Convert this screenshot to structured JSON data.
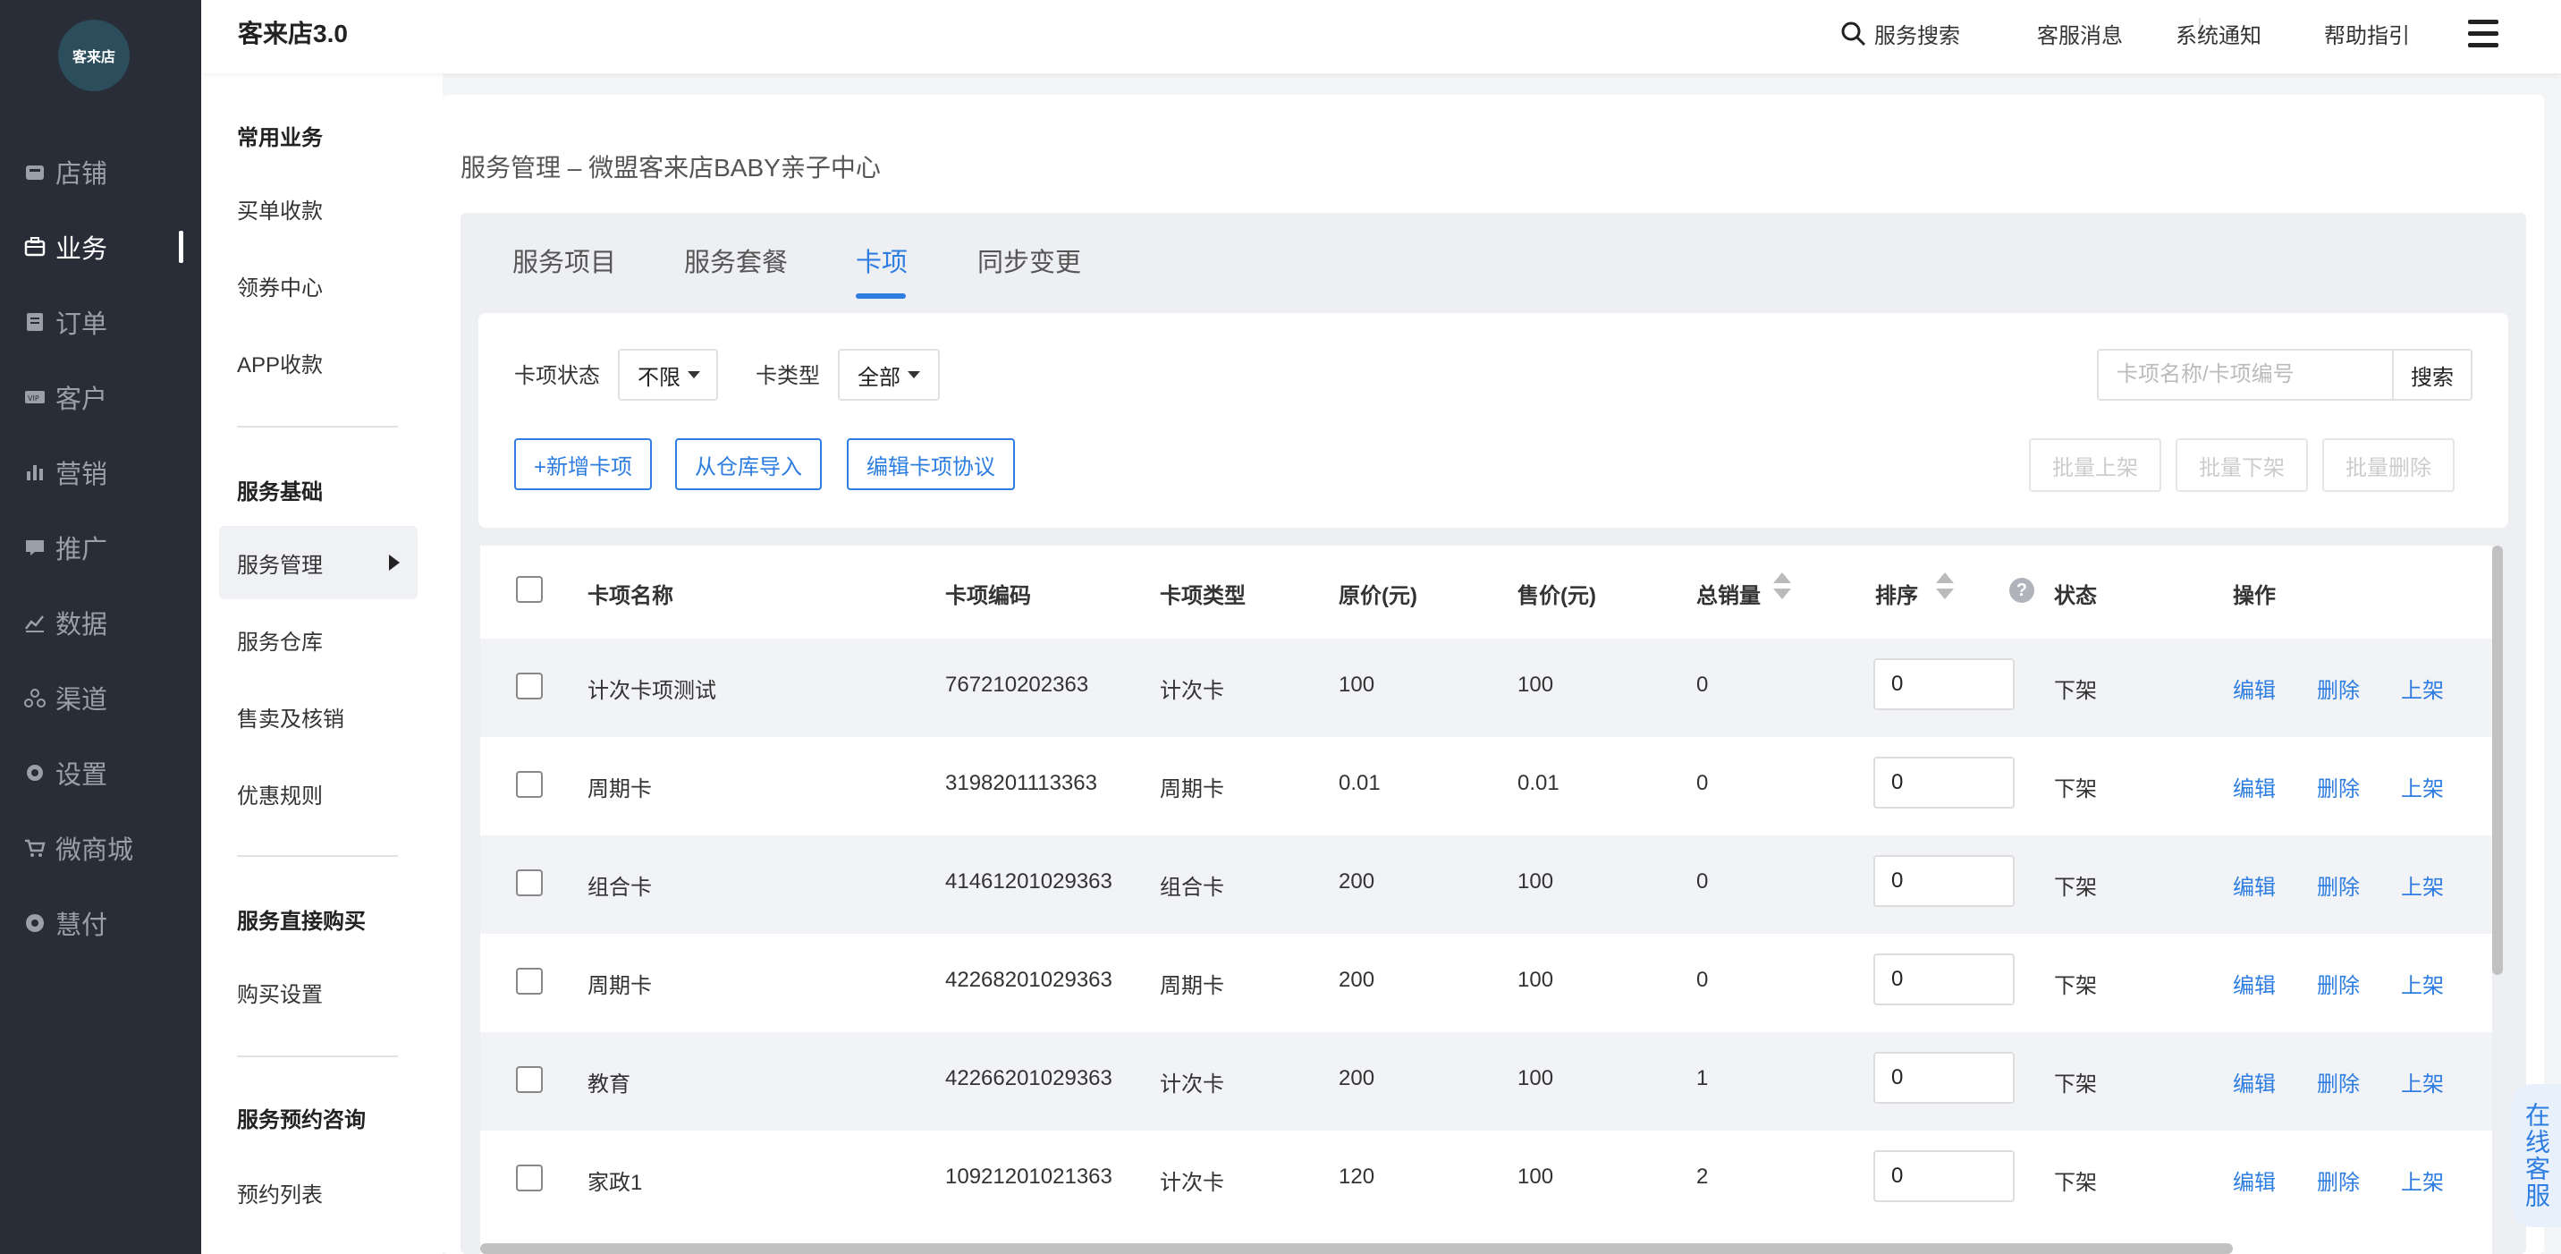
{
  "brand": {
    "logo_text": "客来店"
  },
  "app_title": "客来店3.0",
  "left_nav": [
    {
      "label": "店铺",
      "icon": "store-icon",
      "active": false
    },
    {
      "label": "业务",
      "icon": "briefcase-icon",
      "active": true
    },
    {
      "label": "订单",
      "icon": "order-icon",
      "active": false
    },
    {
      "label": "客户",
      "icon": "vip-card-icon",
      "active": false
    },
    {
      "label": "营销",
      "icon": "bar-chart-icon",
      "active": false
    },
    {
      "label": "推广",
      "icon": "chat-icon",
      "active": false
    },
    {
      "label": "数据",
      "icon": "line-chart-icon",
      "active": false
    },
    {
      "label": "渠道",
      "icon": "channel-icon",
      "active": false
    },
    {
      "label": "设置",
      "icon": "gear-icon",
      "active": false
    },
    {
      "label": "微商城",
      "icon": "cart-icon",
      "active": false
    },
    {
      "label": "慧付",
      "icon": "pay-icon",
      "active": false
    }
  ],
  "submenu": {
    "group1_title": "常用业务",
    "group1_items": [
      "买单收款",
      "领券中心",
      "APP收款"
    ],
    "group2_title": "服务基础",
    "group2_items": [
      "服务管理",
      "服务仓库",
      "售卖及核销",
      "优惠规则"
    ],
    "group3_title": "服务直接购买",
    "group3_items": [
      "购买设置"
    ],
    "group4_title": "服务预约咨询",
    "group4_items": [
      "预约列表"
    ]
  },
  "topbar": {
    "search": "服务搜索",
    "cs_msg": "客服消息",
    "sys_notice": "系统通知",
    "help": "帮助指引"
  },
  "page_title": "服务管理 – 微盟客来店BABY亲子中心",
  "tabs": [
    "服务项目",
    "服务套餐",
    "卡项",
    "同步变更"
  ],
  "active_tab": "卡项",
  "filters": {
    "status_label": "卡项状态",
    "status_value": "不限",
    "type_label": "卡类型",
    "type_value": "全部",
    "search_placeholder": "卡项名称/卡项编号",
    "search_btn": "搜索"
  },
  "actions": {
    "add": "+新增卡项",
    "import": "从仓库导入",
    "edit_protocol": "编辑卡项协议",
    "batch_on": "批量上架",
    "batch_off": "批量下架",
    "batch_delete": "批量删除"
  },
  "table": {
    "headers": {
      "name": "卡项名称",
      "code": "卡项编码",
      "type": "卡项类型",
      "orig_price": "原价(元)",
      "price": "售价(元)",
      "sales": "总销量",
      "sort": "排序",
      "status": "状态",
      "ops": "操作"
    },
    "op_labels": {
      "edit": "编辑",
      "delete": "删除",
      "on": "上架"
    },
    "rows": [
      {
        "name": "计次卡项测试",
        "code": "767210202363",
        "type": "计次卡",
        "orig": "100",
        "price": "100",
        "sales": "0",
        "sort": "0",
        "status": "下架"
      },
      {
        "name": "周期卡",
        "code": "3198201113363",
        "type": "周期卡",
        "orig": "0.01",
        "price": "0.01",
        "sales": "0",
        "sort": "0",
        "status": "下架"
      },
      {
        "name": "组合卡",
        "code": "41461201029363",
        "type": "组合卡",
        "orig": "200",
        "price": "100",
        "sales": "0",
        "sort": "0",
        "status": "下架"
      },
      {
        "name": "周期卡",
        "code": "42268201029363",
        "type": "周期卡",
        "orig": "200",
        "price": "100",
        "sales": "0",
        "sort": "0",
        "status": "下架"
      },
      {
        "name": "教育",
        "code": "42266201029363",
        "type": "计次卡",
        "orig": "200",
        "price": "100",
        "sales": "1",
        "sort": "0",
        "status": "下架"
      },
      {
        "name": "家政1",
        "code": "10921201021363",
        "type": "计次卡",
        "orig": "120",
        "price": "100",
        "sales": "2",
        "sort": "0",
        "status": "下架"
      }
    ]
  },
  "online_cs": "在线客服",
  "colors": {
    "accent": "#2e7de1",
    "nav_bg": "#282d37"
  }
}
